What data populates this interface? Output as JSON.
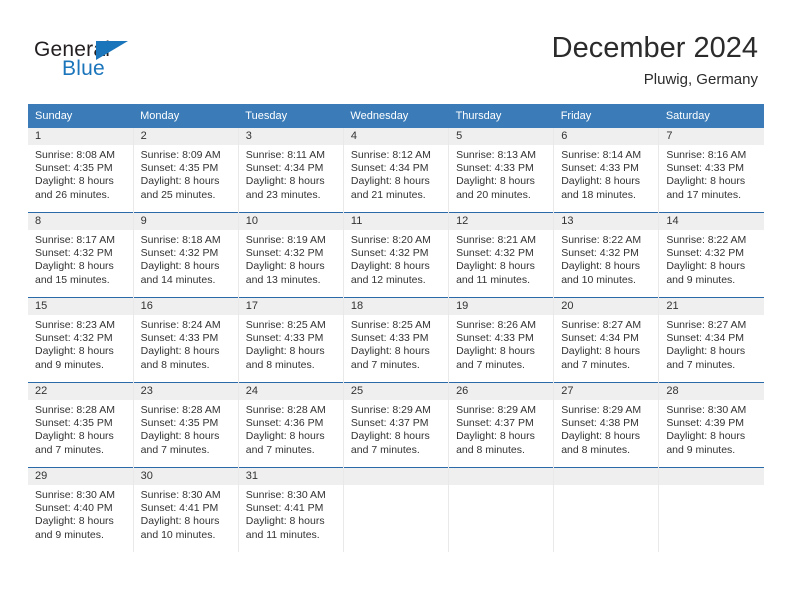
{
  "logo": {
    "word_top": "General",
    "word_bottom": "Blue",
    "triangle_color": "#1b75bb",
    "text_color": "#231f20"
  },
  "header": {
    "title": "December 2024",
    "subtitle": "Pluwig, Germany"
  },
  "theme": {
    "header_blue": "#3b7cb8",
    "row_divider_blue": "#2a6aa8",
    "daynum_band_gray": "#efefef",
    "text_color": "#333333"
  },
  "weekday_headers": [
    "Sunday",
    "Monday",
    "Tuesday",
    "Wednesday",
    "Thursday",
    "Friday",
    "Saturday"
  ],
  "weeks": [
    [
      {
        "day": "1",
        "sunrise": "Sunrise: 8:08 AM",
        "sunset": "Sunset: 4:35 PM",
        "daylight_line1": "Daylight: 8 hours",
        "daylight_line2": "and 26 minutes."
      },
      {
        "day": "2",
        "sunrise": "Sunrise: 8:09 AM",
        "sunset": "Sunset: 4:35 PM",
        "daylight_line1": "Daylight: 8 hours",
        "daylight_line2": "and 25 minutes."
      },
      {
        "day": "3",
        "sunrise": "Sunrise: 8:11 AM",
        "sunset": "Sunset: 4:34 PM",
        "daylight_line1": "Daylight: 8 hours",
        "daylight_line2": "and 23 minutes."
      },
      {
        "day": "4",
        "sunrise": "Sunrise: 8:12 AM",
        "sunset": "Sunset: 4:34 PM",
        "daylight_line1": "Daylight: 8 hours",
        "daylight_line2": "and 21 minutes."
      },
      {
        "day": "5",
        "sunrise": "Sunrise: 8:13 AM",
        "sunset": "Sunset: 4:33 PM",
        "daylight_line1": "Daylight: 8 hours",
        "daylight_line2": "and 20 minutes."
      },
      {
        "day": "6",
        "sunrise": "Sunrise: 8:14 AM",
        "sunset": "Sunset: 4:33 PM",
        "daylight_line1": "Daylight: 8 hours",
        "daylight_line2": "and 18 minutes."
      },
      {
        "day": "7",
        "sunrise": "Sunrise: 8:16 AM",
        "sunset": "Sunset: 4:33 PM",
        "daylight_line1": "Daylight: 8 hours",
        "daylight_line2": "and 17 minutes."
      }
    ],
    [
      {
        "day": "8",
        "sunrise": "Sunrise: 8:17 AM",
        "sunset": "Sunset: 4:32 PM",
        "daylight_line1": "Daylight: 8 hours",
        "daylight_line2": "and 15 minutes."
      },
      {
        "day": "9",
        "sunrise": "Sunrise: 8:18 AM",
        "sunset": "Sunset: 4:32 PM",
        "daylight_line1": "Daylight: 8 hours",
        "daylight_line2": "and 14 minutes."
      },
      {
        "day": "10",
        "sunrise": "Sunrise: 8:19 AM",
        "sunset": "Sunset: 4:32 PM",
        "daylight_line1": "Daylight: 8 hours",
        "daylight_line2": "and 13 minutes."
      },
      {
        "day": "11",
        "sunrise": "Sunrise: 8:20 AM",
        "sunset": "Sunset: 4:32 PM",
        "daylight_line1": "Daylight: 8 hours",
        "daylight_line2": "and 12 minutes."
      },
      {
        "day": "12",
        "sunrise": "Sunrise: 8:21 AM",
        "sunset": "Sunset: 4:32 PM",
        "daylight_line1": "Daylight: 8 hours",
        "daylight_line2": "and 11 minutes."
      },
      {
        "day": "13",
        "sunrise": "Sunrise: 8:22 AM",
        "sunset": "Sunset: 4:32 PM",
        "daylight_line1": "Daylight: 8 hours",
        "daylight_line2": "and 10 minutes."
      },
      {
        "day": "14",
        "sunrise": "Sunrise: 8:22 AM",
        "sunset": "Sunset: 4:32 PM",
        "daylight_line1": "Daylight: 8 hours",
        "daylight_line2": "and 9 minutes."
      }
    ],
    [
      {
        "day": "15",
        "sunrise": "Sunrise: 8:23 AM",
        "sunset": "Sunset: 4:32 PM",
        "daylight_line1": "Daylight: 8 hours",
        "daylight_line2": "and 9 minutes."
      },
      {
        "day": "16",
        "sunrise": "Sunrise: 8:24 AM",
        "sunset": "Sunset: 4:33 PM",
        "daylight_line1": "Daylight: 8 hours",
        "daylight_line2": "and 8 minutes."
      },
      {
        "day": "17",
        "sunrise": "Sunrise: 8:25 AM",
        "sunset": "Sunset: 4:33 PM",
        "daylight_line1": "Daylight: 8 hours",
        "daylight_line2": "and 8 minutes."
      },
      {
        "day": "18",
        "sunrise": "Sunrise: 8:25 AM",
        "sunset": "Sunset: 4:33 PM",
        "daylight_line1": "Daylight: 8 hours",
        "daylight_line2": "and 7 minutes."
      },
      {
        "day": "19",
        "sunrise": "Sunrise: 8:26 AM",
        "sunset": "Sunset: 4:33 PM",
        "daylight_line1": "Daylight: 8 hours",
        "daylight_line2": "and 7 minutes."
      },
      {
        "day": "20",
        "sunrise": "Sunrise: 8:27 AM",
        "sunset": "Sunset: 4:34 PM",
        "daylight_line1": "Daylight: 8 hours",
        "daylight_line2": "and 7 minutes."
      },
      {
        "day": "21",
        "sunrise": "Sunrise: 8:27 AM",
        "sunset": "Sunset: 4:34 PM",
        "daylight_line1": "Daylight: 8 hours",
        "daylight_line2": "and 7 minutes."
      }
    ],
    [
      {
        "day": "22",
        "sunrise": "Sunrise: 8:28 AM",
        "sunset": "Sunset: 4:35 PM",
        "daylight_line1": "Daylight: 8 hours",
        "daylight_line2": "and 7 minutes."
      },
      {
        "day": "23",
        "sunrise": "Sunrise: 8:28 AM",
        "sunset": "Sunset: 4:35 PM",
        "daylight_line1": "Daylight: 8 hours",
        "daylight_line2": "and 7 minutes."
      },
      {
        "day": "24",
        "sunrise": "Sunrise: 8:28 AM",
        "sunset": "Sunset: 4:36 PM",
        "daylight_line1": "Daylight: 8 hours",
        "daylight_line2": "and 7 minutes."
      },
      {
        "day": "25",
        "sunrise": "Sunrise: 8:29 AM",
        "sunset": "Sunset: 4:37 PM",
        "daylight_line1": "Daylight: 8 hours",
        "daylight_line2": "and 7 minutes."
      },
      {
        "day": "26",
        "sunrise": "Sunrise: 8:29 AM",
        "sunset": "Sunset: 4:37 PM",
        "daylight_line1": "Daylight: 8 hours",
        "daylight_line2": "and 8 minutes."
      },
      {
        "day": "27",
        "sunrise": "Sunrise: 8:29 AM",
        "sunset": "Sunset: 4:38 PM",
        "daylight_line1": "Daylight: 8 hours",
        "daylight_line2": "and 8 minutes."
      },
      {
        "day": "28",
        "sunrise": "Sunrise: 8:30 AM",
        "sunset": "Sunset: 4:39 PM",
        "daylight_line1": "Daylight: 8 hours",
        "daylight_line2": "and 9 minutes."
      }
    ],
    [
      {
        "day": "29",
        "sunrise": "Sunrise: 8:30 AM",
        "sunset": "Sunset: 4:40 PM",
        "daylight_line1": "Daylight: 8 hours",
        "daylight_line2": "and 9 minutes."
      },
      {
        "day": "30",
        "sunrise": "Sunrise: 8:30 AM",
        "sunset": "Sunset: 4:41 PM",
        "daylight_line1": "Daylight: 8 hours",
        "daylight_line2": "and 10 minutes."
      },
      {
        "day": "31",
        "sunrise": "Sunrise: 8:30 AM",
        "sunset": "Sunset: 4:41 PM",
        "daylight_line1": "Daylight: 8 hours",
        "daylight_line2": "and 11 minutes."
      },
      {
        "day": "",
        "sunrise": "",
        "sunset": "",
        "daylight_line1": "",
        "daylight_line2": ""
      },
      {
        "day": "",
        "sunrise": "",
        "sunset": "",
        "daylight_line1": "",
        "daylight_line2": ""
      },
      {
        "day": "",
        "sunrise": "",
        "sunset": "",
        "daylight_line1": "",
        "daylight_line2": ""
      },
      {
        "day": "",
        "sunrise": "",
        "sunset": "",
        "daylight_line1": "",
        "daylight_line2": ""
      }
    ]
  ]
}
